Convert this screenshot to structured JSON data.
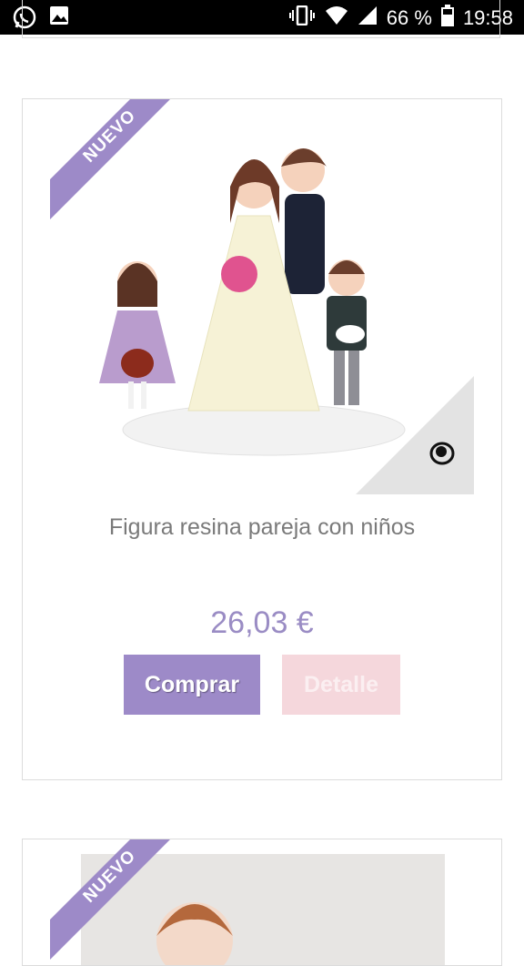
{
  "status_bar": {
    "battery": "66 %",
    "time": "19:58",
    "icons": [
      "whatsapp-icon",
      "gallery-icon",
      "vibrate-icon",
      "wifi-icon",
      "signal-icon",
      "battery-icon"
    ]
  },
  "products": [
    {
      "badge": "NUEVO",
      "title": "Figura resina pareja con niños",
      "price": "26,03 €",
      "buy_label": "Comprar",
      "detail_label": "Detalle"
    },
    {
      "badge": "NUEVO"
    }
  ],
  "colors": {
    "accent": "#9d8ac8",
    "price": "#9a8cc4",
    "detail_button": "#f5d7dc",
    "border": "#dcdcdc"
  }
}
